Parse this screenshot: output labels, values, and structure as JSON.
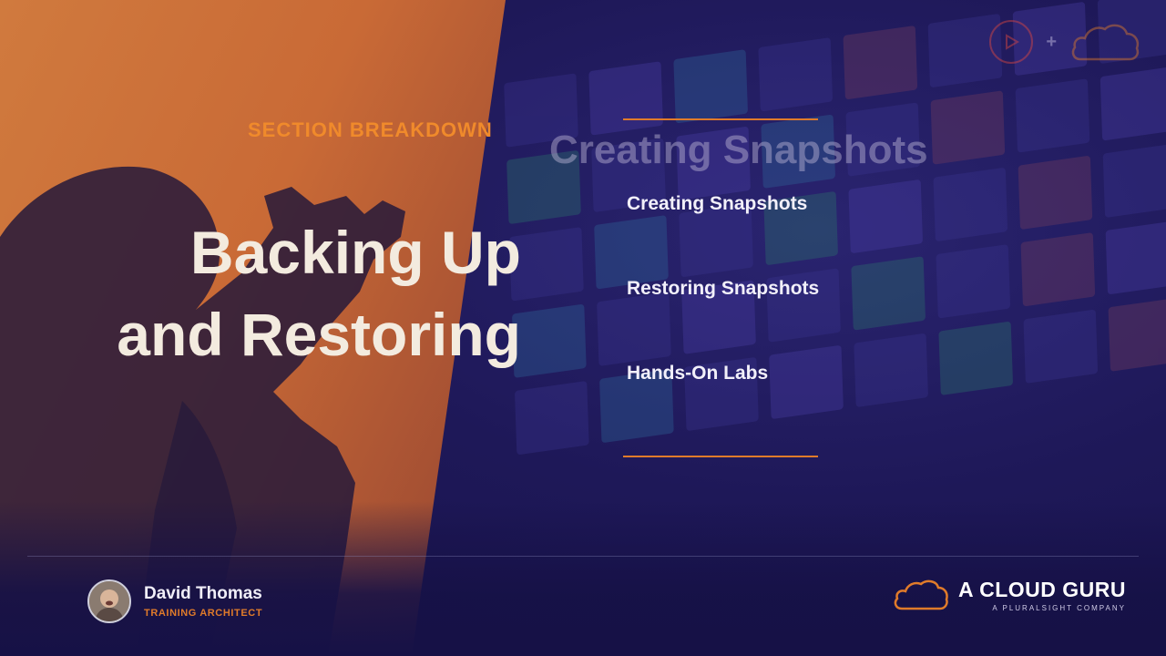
{
  "slide": {
    "section_label": "SECTION BREAKDOWN",
    "title_line1": "Backing Up",
    "title_line2": "and Restoring",
    "ghost_title": "Creating Snapshots"
  },
  "topics": [
    {
      "label": "Creating Snapshots"
    },
    {
      "label": "Restoring Snapshots"
    },
    {
      "label": "Hands-On Labs"
    }
  ],
  "presenter": {
    "name": "David Thomas",
    "role": "TRAINING ARCHITECT"
  },
  "brand": {
    "name": "A CLOUD GURU",
    "tagline": "A PLURALSIGHT COMPANY"
  },
  "top_logos": {
    "plus": "+",
    "icons": [
      "pluralsight-play-icon",
      "cloud-guru-cloud-icon"
    ]
  },
  "colors": {
    "accent": "#e07b2a",
    "background": "#1b1650",
    "title": "#f3ebdf"
  }
}
